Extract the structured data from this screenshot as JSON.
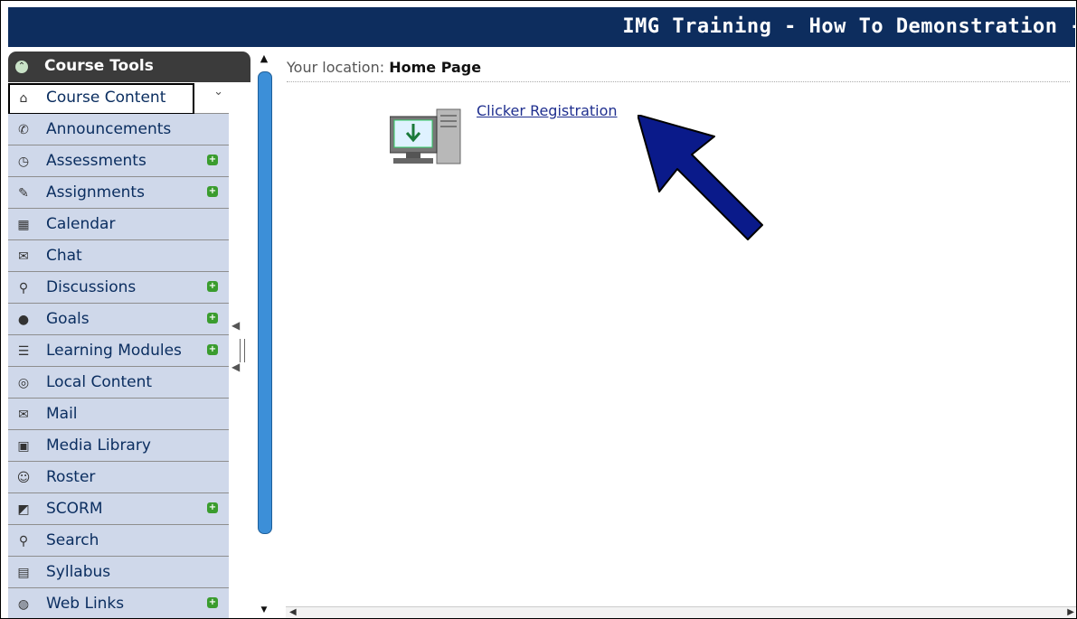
{
  "header": {
    "title": "IMG Training - How To Demonstration -"
  },
  "sidebar": {
    "heading": "Course Tools",
    "items": [
      {
        "label": "Course Content",
        "icon": "house-icon",
        "active": true,
        "has_plus": false,
        "chevron": "double-chevron-down-icon"
      },
      {
        "label": "Announcements",
        "icon": "megaphone-icon",
        "active": false,
        "has_plus": false
      },
      {
        "label": "Assessments",
        "icon": "stopwatch-icon",
        "active": false,
        "has_plus": true
      },
      {
        "label": "Assignments",
        "icon": "pencil-icon",
        "active": false,
        "has_plus": true
      },
      {
        "label": "Calendar",
        "icon": "calendar-icon",
        "active": false,
        "has_plus": false
      },
      {
        "label": "Chat",
        "icon": "chat-bubble-icon",
        "active": false,
        "has_plus": false
      },
      {
        "label": "Discussions",
        "icon": "pushpin-icon",
        "active": false,
        "has_plus": true
      },
      {
        "label": "Goals",
        "icon": "apple-icon",
        "active": false,
        "has_plus": true
      },
      {
        "label": "Learning Modules",
        "icon": "document-icon",
        "active": false,
        "has_plus": true
      },
      {
        "label": "Local Content",
        "icon": "disc-icon",
        "active": false,
        "has_plus": false
      },
      {
        "label": "Mail",
        "icon": "mail-icon",
        "active": false,
        "has_plus": false
      },
      {
        "label": "Media Library",
        "icon": "media-icon",
        "active": false,
        "has_plus": false
      },
      {
        "label": "Roster",
        "icon": "people-icon",
        "active": false,
        "has_plus": false
      },
      {
        "label": "SCORM",
        "icon": "scorm-icon",
        "active": false,
        "has_plus": true
      },
      {
        "label": "Search",
        "icon": "magnifier-icon",
        "active": false,
        "has_plus": false
      },
      {
        "label": "Syllabus",
        "icon": "syllabus-icon",
        "active": false,
        "has_plus": false
      },
      {
        "label": "Web Links",
        "icon": "globe-icon",
        "active": false,
        "has_plus": true
      }
    ]
  },
  "main": {
    "location_label": "Your location:",
    "location_page": "Home Page",
    "link_label": "Clicker Registration"
  },
  "colors": {
    "header_bg": "#0d2d5e",
    "nav_bg": "#cfd8ea",
    "plus_green": "#3a9c2e",
    "arrow_fill": "#0a1a8a",
    "scroll_thumb": "#3c8fd8"
  }
}
